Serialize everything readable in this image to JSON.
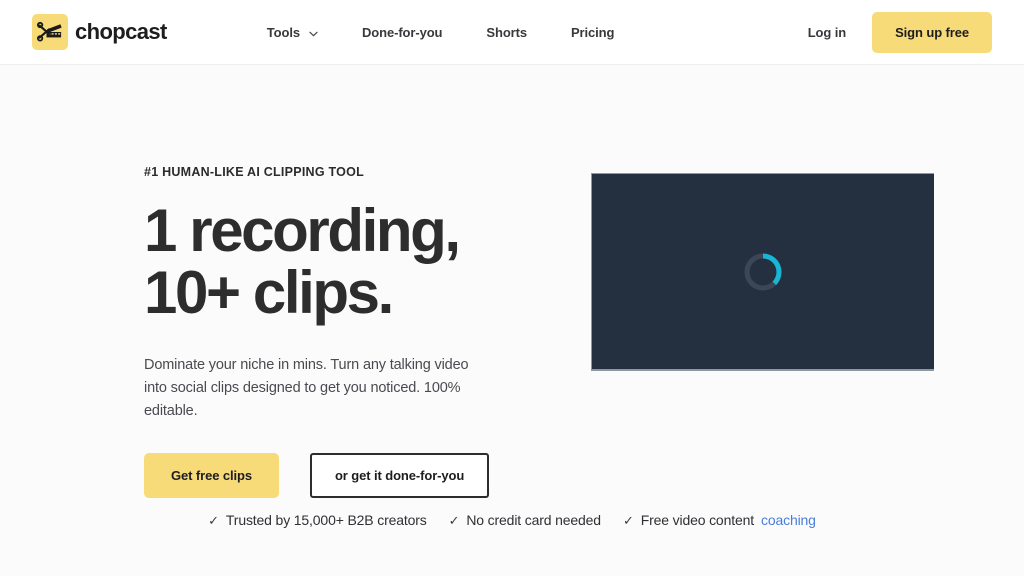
{
  "brand": {
    "name": "chopcast",
    "mark_icon": "scissors-film-icon",
    "mark_color": "#f7db79"
  },
  "header": {
    "nav": [
      {
        "label": "Tools",
        "has_dropdown": true,
        "icon": "chevron-down-icon"
      },
      {
        "label": "Done-for-you",
        "has_dropdown": false
      },
      {
        "label": "Shorts",
        "has_dropdown": false
      },
      {
        "label": "Pricing",
        "has_dropdown": false
      }
    ],
    "login_label": "Log in",
    "signup_label": "Sign up free"
  },
  "hero": {
    "eyebrow": "#1 HUMAN-LIKE AI CLIPPING TOOL",
    "headline_line1": "1 recording,",
    "headline_line2": "10+ clips.",
    "subhead": "Dominate your niche in mins. Turn any talking video into social clips designed to get you noticed. 100% editable.",
    "cta_primary": "Get free clips",
    "cta_secondary": "or get it done-for-you"
  },
  "video": {
    "state": "loading",
    "spinner_icon": "loading-spinner-icon",
    "background_color": "#242f40",
    "spinner_accent_color": "#19b5d4",
    "spinner_track_color": "#3b4656"
  },
  "trust_bar": {
    "check_icon": "check-icon",
    "items": [
      {
        "text": "Trusted by 15,000+ B2B creators",
        "link_text": ""
      },
      {
        "text": "No credit card needed",
        "link_text": ""
      },
      {
        "text": "Free video content ",
        "link_text": "coaching"
      }
    ]
  },
  "colors": {
    "accent_yellow": "#f7db79",
    "page_background": "#fbfbfc",
    "header_background": "#ffffff",
    "text_dark": "#2d2d2d",
    "link_blue": "#4a7ddb"
  }
}
